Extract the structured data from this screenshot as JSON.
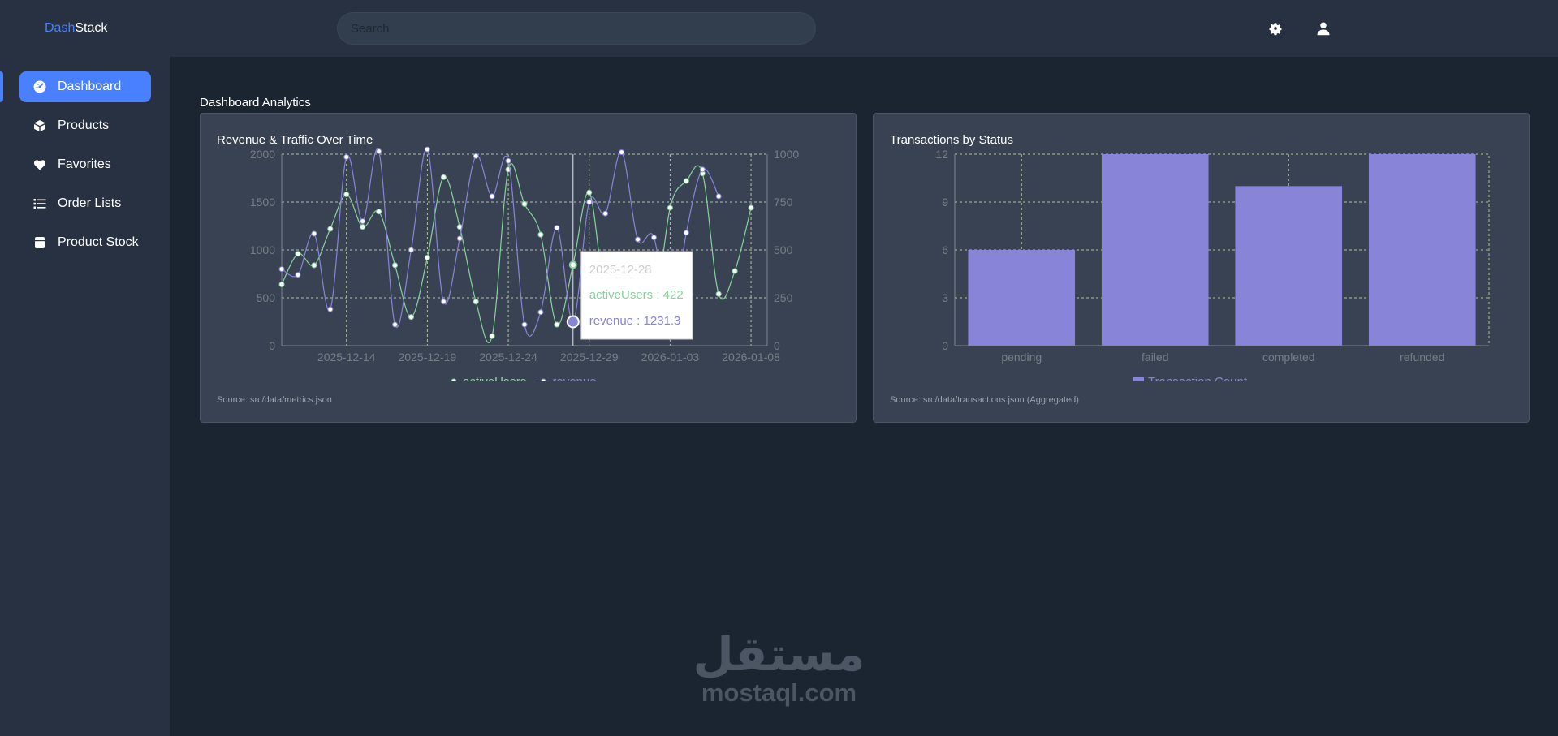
{
  "app": {
    "logo_accent": "Dash",
    "logo_rest": "Stack"
  },
  "search": {
    "placeholder": "Search"
  },
  "header_icons": [
    "gear-icon",
    "user-icon"
  ],
  "sidebar": {
    "items": [
      {
        "label": "Dashboard",
        "icon": "dashboard-icon",
        "active": true
      },
      {
        "label": "Products",
        "icon": "box-icon",
        "active": false
      },
      {
        "label": "Favorites",
        "icon": "heart-icon",
        "active": false
      },
      {
        "label": "Order Lists",
        "icon": "list-icon",
        "active": false
      },
      {
        "label": "Product Stock",
        "icon": "database-icon",
        "active": false
      }
    ]
  },
  "page": {
    "title": "Dashboard Analytics"
  },
  "colors": {
    "accent": "#4880ff",
    "active_users": "#86d39c",
    "revenue": "#8884d8",
    "bar": "#8884d8"
  },
  "cards": {
    "line": {
      "title": "Revenue & Traffic Over Time",
      "source": "Source: src/data/metrics.json"
    },
    "bar": {
      "title": "Transactions by Status",
      "source": "Source: src/data/transactions.json (Aggregated)"
    }
  },
  "tooltip": {
    "date": "2025-12-28",
    "active_users_label": "activeUsers : 422",
    "revenue_label": "revenue : 1231.3"
  },
  "watermark": {
    "arabic": "مستقل",
    "latin": "mostaql.com"
  },
  "chart_data": [
    {
      "type": "line",
      "title": "Revenue & Traffic Over Time",
      "x_start": "2025-12-10",
      "x": [
        "2025-12-10",
        "2025-12-11",
        "2025-12-12",
        "2025-12-13",
        "2025-12-14",
        "2025-12-15",
        "2025-12-16",
        "2025-12-17",
        "2025-12-18",
        "2025-12-19",
        "2025-12-20",
        "2025-12-21",
        "2025-12-22",
        "2025-12-23",
        "2025-12-24",
        "2025-12-25",
        "2025-12-26",
        "2025-12-27",
        "2025-12-28",
        "2025-12-29",
        "2025-12-30",
        "2025-12-31",
        "2026-01-01",
        "2026-01-02",
        "2026-01-03",
        "2026-01-04",
        "2026-01-05",
        "2026-01-06",
        "2026-01-07",
        "2026-01-08",
        "2026-01-09"
      ],
      "x_ticks": [
        "2025-12-14",
        "2025-12-19",
        "2025-12-24",
        "2025-12-29",
        "2026-01-03",
        "2026-01-08"
      ],
      "left_ylim": [
        0,
        2000
      ],
      "left_ticks": [
        0,
        500,
        1000,
        1500,
        2000
      ],
      "right_ylim": [
        0,
        1000
      ],
      "right_ticks": [
        0,
        250,
        500,
        750,
        1000
      ],
      "series": [
        {
          "name": "activeUsers",
          "axis": "right",
          "values": [
            320,
            480,
            420,
            610,
            790,
            620,
            700,
            420,
            150,
            460,
            880,
            620,
            230,
            50,
            920,
            740,
            580,
            110,
            422,
            800,
            240,
            140,
            130,
            150,
            720,
            860,
            900,
            270,
            390,
            720
          ]
        },
        {
          "name": "revenue",
          "axis": "left",
          "values": [
            800,
            740,
            1170,
            380,
            1970,
            1300,
            2030,
            220,
            1000,
            2050,
            460,
            1120,
            1980,
            1560,
            1930,
            220,
            350,
            1231.3,
            250,
            1500,
            1380,
            2020,
            1110,
            1130,
            180,
            1180,
            1840,
            1560
          ]
        }
      ],
      "legend": [
        "activeUsers",
        "revenue"
      ],
      "grid": true,
      "active_index": 18
    },
    {
      "type": "bar",
      "title": "Transactions by Status",
      "categories": [
        "pending",
        "failed",
        "completed",
        "refunded"
      ],
      "values": [
        6,
        12,
        10,
        12
      ],
      "ylim": [
        0,
        12
      ],
      "y_ticks": [
        0,
        3,
        6,
        9,
        12
      ],
      "legend": [
        "Transaction Count"
      ],
      "grid": true
    }
  ]
}
